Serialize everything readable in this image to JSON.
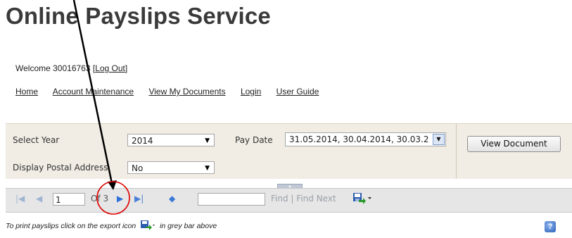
{
  "header": {
    "title": "Online Payslips Service"
  },
  "user": {
    "welcome": "Welcome 30016763 [",
    "logout": "Log Out",
    "close_bracket": "]"
  },
  "nav": {
    "items": [
      "Home",
      "Account Maintenance",
      "View My Documents",
      "Login",
      "User Guide"
    ]
  },
  "params": {
    "year_label": "Select Year",
    "year_value": "2014",
    "paydate_label": "Pay Date",
    "paydate_value": "31.05.2014, 30.04.2014, 30.03.2",
    "address_label": "Display Postal Address",
    "address_value": "No",
    "view_button": "View Document"
  },
  "toolbar": {
    "page_value": "1",
    "of_text": "Of 3",
    "find_link": "Find",
    "separator": "|",
    "find_next_link": "Find Next"
  },
  "footer": {
    "hint_before": "To print payslips click on the export icon",
    "hint_after": "in grey bar above"
  },
  "icons": {
    "first": "first-page-icon",
    "prev": "previous-page-icon",
    "next": "next-page-icon",
    "last": "last-page-icon",
    "back": "back-to-parent-icon",
    "export": "export-icon",
    "help": "help-icon"
  },
  "colors": {
    "annotation": "#e00000",
    "accent": "#2f6fd6"
  }
}
